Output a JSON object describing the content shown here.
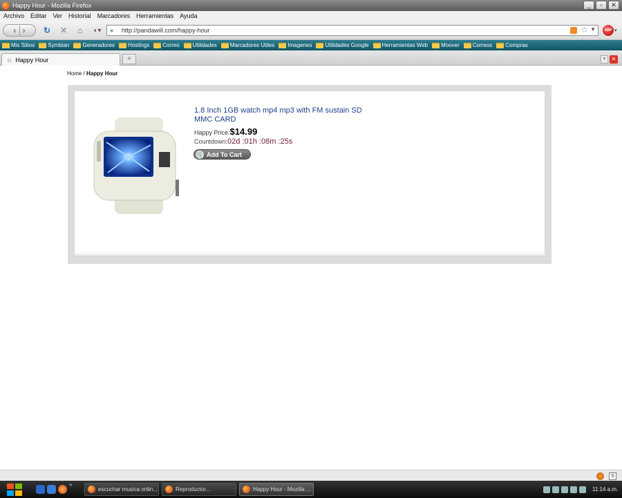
{
  "window": {
    "title": "Happy Hour - Mozilla Firefox"
  },
  "menubar": [
    "Archivo",
    "Editar",
    "Ver",
    "Historial",
    "Marcadores",
    "Herramientas",
    "Ayuda"
  ],
  "navbar": {
    "url": "http://pandawill.com/happy-hour",
    "abp_label": "ABP"
  },
  "bookmarks": [
    "Mis Sitios",
    "Symbian",
    "Generadores",
    "Hostings",
    "Correo",
    "Utilidades",
    "Marcadores Utiles",
    "Imagenes",
    "Utilidades Google",
    "Herramientas Web",
    "Moover",
    "Correos",
    "Compras"
  ],
  "tabs": [
    {
      "label": "Happy Hour"
    }
  ],
  "newtab_label": "+",
  "breadcrumb": {
    "home": "Home",
    "sep": " / ",
    "current": "Happy Hour"
  },
  "product": {
    "title": "1.8 Inch 1GB watch mp4 mp3 with FM sustain SD MMC CARD",
    "price_label": "Happy Price:",
    "price": "$14.99",
    "countdown_label": "Countdown:",
    "countdown": "02d :01h :08m :25s",
    "add_to_cart": "Add To Cart"
  },
  "taskbar": {
    "items": [
      {
        "label": "escuchar musica onlin..."
      },
      {
        "label": "Reproductor..."
      },
      {
        "label": "Happy Hour - Mozilla ..."
      }
    ],
    "clock": "11:14 a.m."
  }
}
